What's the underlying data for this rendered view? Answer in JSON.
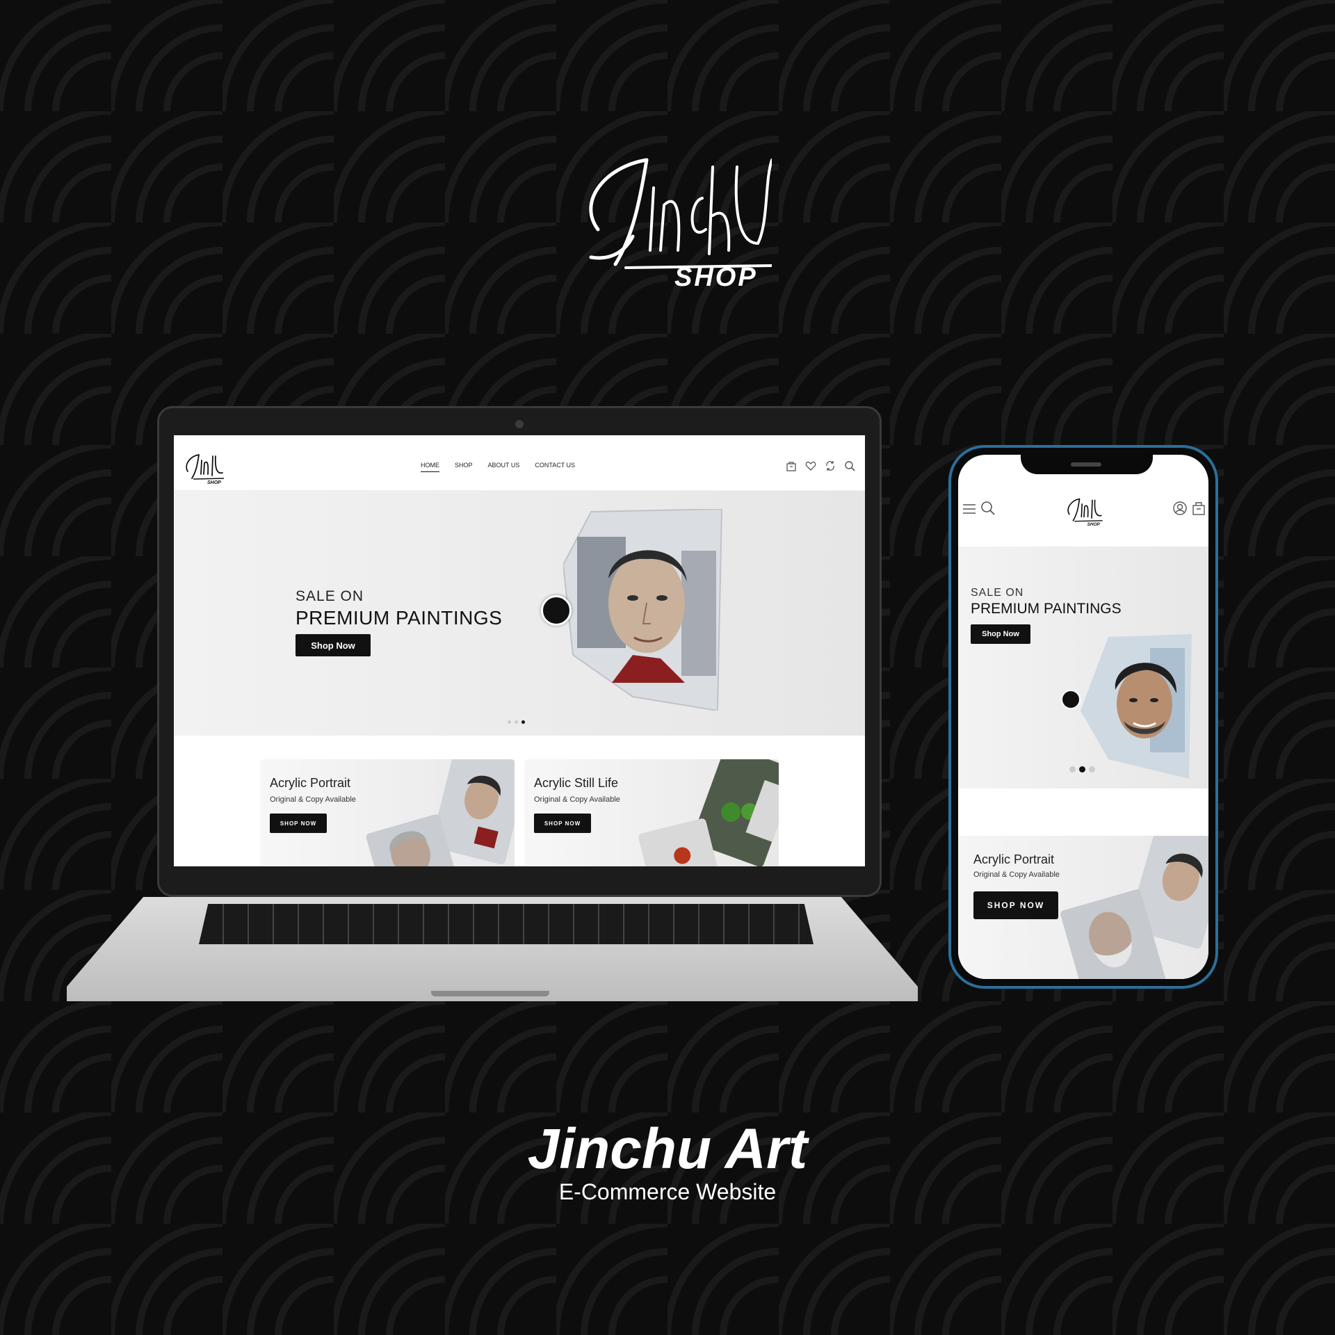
{
  "brand": {
    "logo_text": "JINCHU",
    "logo_sub": "SHOP"
  },
  "laptop_site": {
    "nav": [
      "HOME",
      "SHOP",
      "ABOUT US",
      "CONTACT US"
    ],
    "hero": {
      "sub": "SALE ON",
      "title": "PREMIUM PAINTINGS",
      "button": "Shop Now",
      "slide_index": 3,
      "slide_count": 3
    },
    "cards": [
      {
        "title": "Acrylic Portrait",
        "subtitle": "Original & Copy Available",
        "button": "SHOP NOW"
      },
      {
        "title": "Acrylic Still Life",
        "subtitle": "Original & Copy Available",
        "button": "SHOP NOW"
      }
    ],
    "icons": [
      "cart-icon",
      "heart-icon",
      "compare-icon",
      "search-icon"
    ]
  },
  "phone_site": {
    "hero": {
      "sub": "SALE ON",
      "title": "PREMIUM PAINTINGS",
      "button": "Shop Now",
      "slide_index": 2,
      "slide_count": 3
    },
    "card": {
      "title": "Acrylic Portrait",
      "subtitle": "Original & Copy Available",
      "button": "SHOP NOW"
    },
    "icons": [
      "menu-icon",
      "search-icon",
      "user-icon",
      "cart-icon"
    ]
  },
  "caption": {
    "title": "Jinchu Art",
    "subtitle": "E-Commerce Website"
  },
  "colors": {
    "background": "#0d0d0d",
    "accent": "#111111",
    "phone_frame": "#2b6f9b"
  }
}
